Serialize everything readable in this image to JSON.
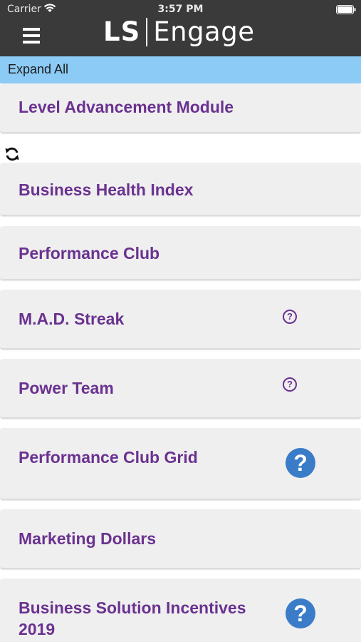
{
  "status_bar": {
    "carrier": "Carrier",
    "time": "3:57 PM"
  },
  "header": {
    "logo_left": "LS",
    "logo_right": "Engage"
  },
  "expand_all_label": "Expand All",
  "modules": [
    {
      "title": "Level Advancement Module",
      "help": "none"
    },
    {
      "title": "Business Health Index",
      "help": "none"
    },
    {
      "title": "Performance Club",
      "help": "none"
    },
    {
      "title": "M.A.D. Streak",
      "help": "outline"
    },
    {
      "title": "Power Team",
      "help": "outline"
    },
    {
      "title": "Performance Club Grid",
      "help": "filled"
    },
    {
      "title": "Marketing Dollars",
      "help": "none"
    },
    {
      "title": "Business Solution Incentives 2019",
      "help": "filled"
    }
  ],
  "help_glyph": "?",
  "icons": [
    "wifi-icon",
    "battery-icon",
    "hamburger-icon",
    "refresh-icon",
    "help-icon"
  ],
  "colors": {
    "header_bg": "#3a3a3a",
    "expand_bar_bg": "#8ccbf6",
    "card_bg": "#efefef",
    "title_purple": "#6a3290",
    "help_blue": "#3a7cc8"
  }
}
